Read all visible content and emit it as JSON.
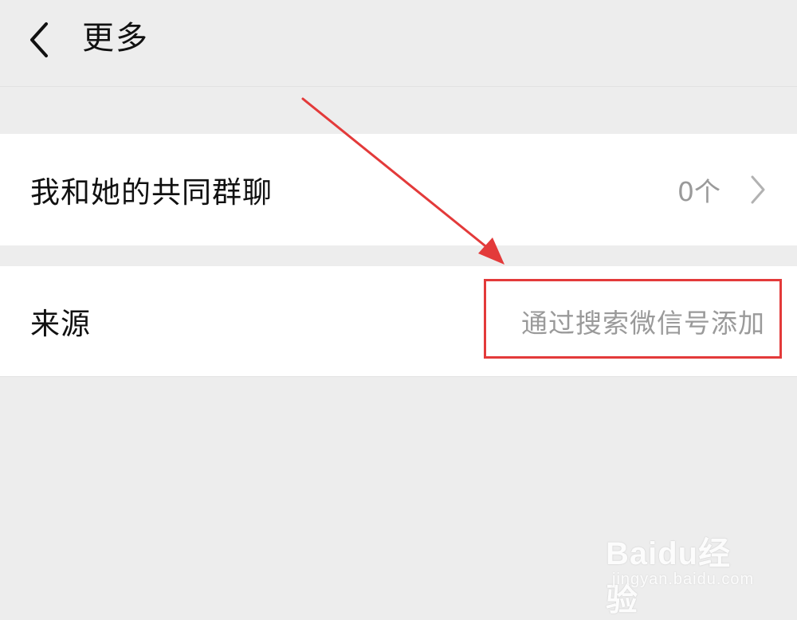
{
  "header": {
    "title": "更多",
    "back_icon": "chevron-left-icon"
  },
  "cells": {
    "groups": {
      "label": "我和她的共同群聊",
      "value": "0个",
      "icon": "chevron-right-icon"
    },
    "source": {
      "label": "来源",
      "value": "通过搜索微信号添加"
    }
  },
  "annotation": {
    "color": "#e33a3a"
  },
  "watermark": {
    "brand": "Baidu经验",
    "url": "jingyan.baidu.com"
  },
  "colors": {
    "background": "#ededed",
    "cell": "#ffffff",
    "secondary_text": "#9a9a9a"
  }
}
